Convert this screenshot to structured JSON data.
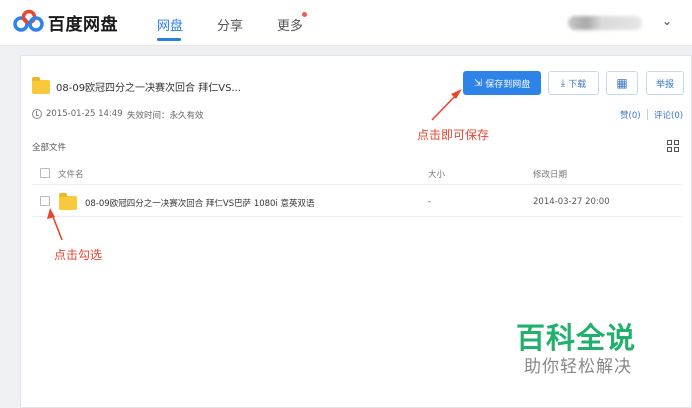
{
  "header": {
    "logo_text": "百度网盘",
    "nav": [
      {
        "label": "网盘",
        "active": true
      },
      {
        "label": "分享",
        "active": false
      },
      {
        "label": "更多",
        "active": false
      }
    ]
  },
  "share": {
    "title": "08-09欧冠四分之一决赛次回合 拜仁VS...",
    "date": "2015-01-25 14:49",
    "expiry": "失效时间：永久有效",
    "buttons": {
      "save": "保存到网盘",
      "download": "下载",
      "report": "举报"
    },
    "like": "赞(0)",
    "comment": "评论(0)"
  },
  "file_list": {
    "breadcrumb": "全部文件",
    "columns": [
      "文件名",
      "大小",
      "修改日期"
    ],
    "rows": [
      {
        "name": "08-09欧冠四分之一决赛次回合 拜仁VS巴萨 1080i 意英双语",
        "size": "-",
        "modified": "2014-03-27 20:00"
      }
    ]
  },
  "annotations": {
    "save_hint": "点击即可保存",
    "check_hint": "点击勾选"
  },
  "watermark": {
    "main": "百科全说",
    "sub": "助你轻松解决"
  },
  "colors": {
    "accent": "#2d83e8",
    "annotation": "#e8462f",
    "watermark": "#21b16d",
    "folder": "#f9c93c"
  }
}
